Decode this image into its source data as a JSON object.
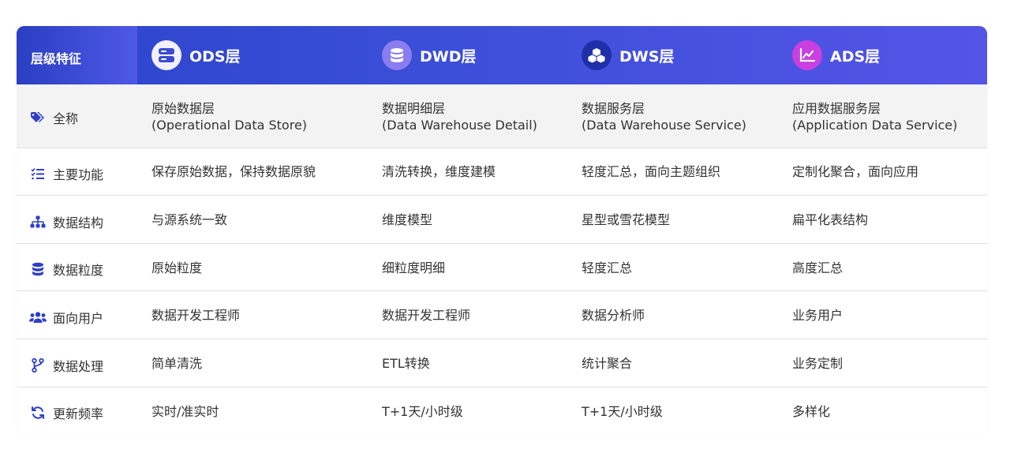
{
  "header": {
    "corner_label": "层级特征",
    "layers": [
      {
        "name": "ODS层",
        "icon": "server-icon",
        "icon_bg": "#f2f0ff"
      },
      {
        "name": "DWD层",
        "icon": "database-icon",
        "icon_bg": "#8b7cf0"
      },
      {
        "name": "DWS层",
        "icon": "cubes-icon",
        "icon_bg": "#1f2fa8"
      },
      {
        "name": "ADS层",
        "icon": "chart-line-icon",
        "icon_bg": "#c93fe0"
      }
    ]
  },
  "colors": {
    "header_start": "#2b44cc",
    "header_end": "#5454e6",
    "row_icon": "#2e3fc7",
    "row_gray": "#f3f3f3",
    "divider": "#dedede"
  },
  "rows": [
    {
      "label": "全称",
      "icon": "tags-icon",
      "cells": [
        [
          "原始数据层",
          "(Operational Data Store)"
        ],
        [
          "数据明细层",
          "(Data Warehouse Detail)"
        ],
        [
          "数据服务层",
          "(Data Warehouse Service)"
        ],
        [
          "应用数据服务层",
          "(Application Data Service)"
        ]
      ]
    },
    {
      "label": "主要功能",
      "icon": "list-check-icon",
      "cells": [
        "保存原始数据，保持数据原貌",
        "清洗转换，维度建模",
        "轻度汇总，面向主题组织",
        "定制化聚合，面向应用"
      ]
    },
    {
      "label": "数据结构",
      "icon": "sitemap-icon",
      "cells": [
        "与源系统一致",
        "维度模型",
        "星型或雪花模型",
        "扁平化表结构"
      ]
    },
    {
      "label": "数据粒度",
      "icon": "database-icon",
      "cells": [
        "原始粒度",
        "细粒度明细",
        "轻度汇总",
        "高度汇总"
      ]
    },
    {
      "label": "面向用户",
      "icon": "users-icon",
      "cells": [
        "数据开发工程师",
        "数据开发工程师",
        "数据分析师",
        "业务用户"
      ]
    },
    {
      "label": "数据处理",
      "icon": "code-branch-icon",
      "cells": [
        "简单清洗",
        "ETL转换",
        "统计聚合",
        "业务定制"
      ]
    },
    {
      "label": "更新频率",
      "icon": "sync-icon",
      "cells": [
        "实时/准实时",
        "T+1天/小时级",
        "T+1天/小时级",
        "多样化"
      ]
    }
  ]
}
